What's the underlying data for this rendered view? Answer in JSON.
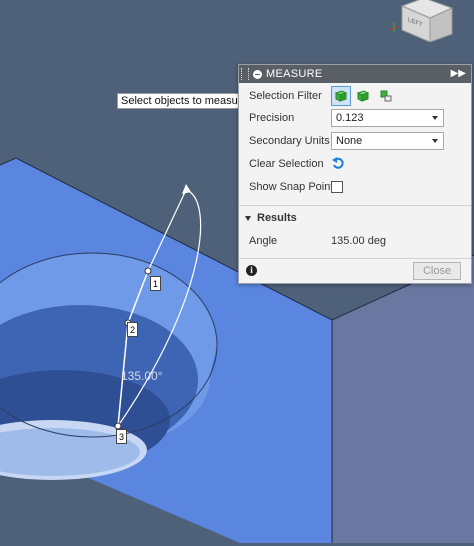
{
  "tooltip": "Select objects to measure.",
  "panel": {
    "title": "MEASURE",
    "selection_filter_label": "Selection Filter",
    "precision_label": "Precision",
    "precision_value": "0.123",
    "secondary_units_label": "Secondary Units",
    "secondary_units_value": "None",
    "clear_selection_label": "Clear Selection",
    "show_snap_points_label": "Show Snap Points",
    "show_snap_points_checked": false,
    "results_header": "Results",
    "result_label": "Angle",
    "result_value": "135.00 deg",
    "close_label": "Close"
  },
  "viewport": {
    "angle_label": "135.00°",
    "points": [
      "1",
      "2",
      "3"
    ],
    "viewcube_text": "LEFT"
  },
  "colors": {
    "background": "#4f6079",
    "model_face": "#5a86e0",
    "accent": "#1f7ed6"
  }
}
